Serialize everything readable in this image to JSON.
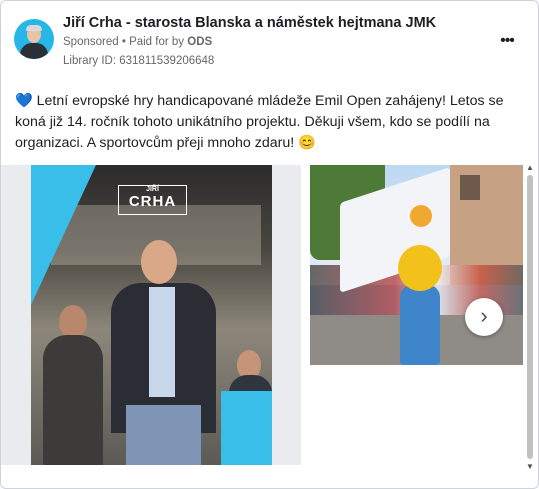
{
  "post": {
    "page_name": "Jiří Crha - starosta Blanska a náměstek hejtmana JMK",
    "sponsored_label": "Sponsored",
    "separator": "•",
    "paid_for_prefix": "Paid for by",
    "paid_for_by": "ODS",
    "library_id": "Library ID: 631811539206648",
    "more_icon": "more-horizontal-icon",
    "text_emoji_start": "💙",
    "text": "Letní evropské hry handicapované mládeže Emil Open zahájeny! Letos se koná již 14. ročník tohoto unikátního projektu. Děkuji všem, kdo se podílí na organizaci. A sportovcům přeji mnoho zdaru!",
    "text_emoji_end": "😊"
  },
  "carousel": {
    "card1": {
      "logo_line1": "JIŘÍ",
      "logo_line2": "CRHA"
    },
    "next_glyph": "›",
    "scroll_up_glyph": "▲",
    "scroll_down_glyph": "▼"
  },
  "colors": {
    "accent_blue": "#39bde9",
    "text_primary": "#1c1e21",
    "text_secondary": "#65676b"
  }
}
